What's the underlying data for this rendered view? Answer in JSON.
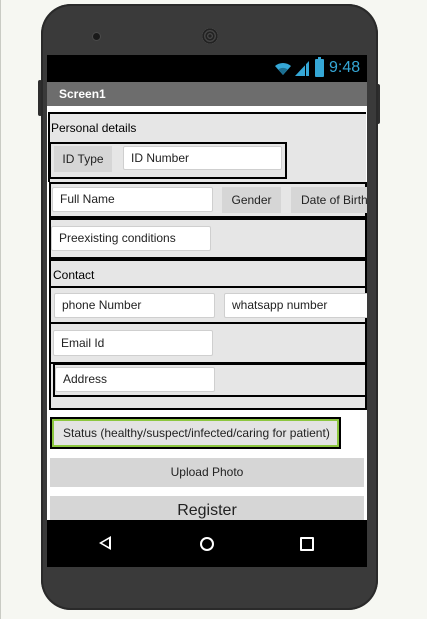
{
  "status_bar": {
    "time": "9:48",
    "icons": [
      "wifi-icon",
      "signal-icon",
      "battery-icon"
    ],
    "accent_color": "#35a7d6"
  },
  "screen": {
    "title": "Screen1",
    "personal": {
      "label": "Personal details",
      "id_type_button": "ID Type",
      "id_number_field": "ID Number",
      "full_name_field": "Full Name",
      "gender_button": "Gender",
      "dob_button": "Date of Birth",
      "preexisting_field": "Preexisting conditions"
    },
    "contact": {
      "label": "Contact",
      "phone_field": "phone Number",
      "whatsapp_field": "whatsapp number",
      "email_field": "Email Id",
      "address_field": "Address"
    },
    "status_button": "Status (healthy/suspect/infected/caring for patient)",
    "status_border_color": "#8cc63f",
    "upload_button": "Upload Photo",
    "register_button": "Register"
  },
  "navbar": {
    "icons": [
      "back-icon",
      "home-icon",
      "recent-apps-icon"
    ]
  }
}
